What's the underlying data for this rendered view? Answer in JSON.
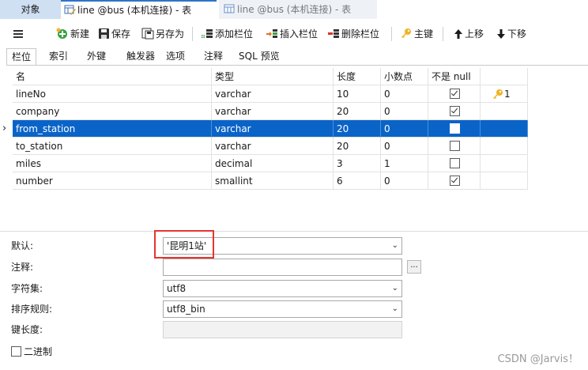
{
  "window_tabs": {
    "object_label": "对象",
    "active_label": "line @bus (本机连接) - 表",
    "inactive_label": "line @bus (本机连接) - 表"
  },
  "toolbar": {
    "new_label": "新建",
    "save_label": "保存",
    "save_as_label": "另存为",
    "add_field_label": "添加栏位",
    "insert_field_label": "插入栏位",
    "delete_field_label": "删除栏位",
    "primary_key_label": "主键",
    "move_up_label": "上移",
    "move_down_label": "下移"
  },
  "sub_tabs": [
    "栏位",
    "索引",
    "外键",
    "触发器",
    "选项",
    "注释",
    "SQL 预览"
  ],
  "grid": {
    "headers": {
      "name": "名",
      "type": "类型",
      "length": "长度",
      "decimals": "小数点",
      "not_null": "不是 null"
    },
    "rows": [
      {
        "name": "lineNo",
        "type": "varchar",
        "length": "10",
        "decimals": "0",
        "not_null": true,
        "key": "1"
      },
      {
        "name": "company",
        "type": "varchar",
        "length": "20",
        "decimals": "0",
        "not_null": true,
        "key": ""
      },
      {
        "name": "from_station",
        "type": "varchar",
        "length": "20",
        "decimals": "0",
        "not_null": false,
        "key": ""
      },
      {
        "name": "to_station",
        "type": "varchar",
        "length": "20",
        "decimals": "0",
        "not_null": false,
        "key": ""
      },
      {
        "name": "miles",
        "type": "decimal",
        "length": "3",
        "decimals": "1",
        "not_null": false,
        "key": ""
      },
      {
        "name": "number",
        "type": "smallint",
        "length": "6",
        "decimals": "0",
        "not_null": true,
        "key": ""
      }
    ],
    "selected_row_index": 2
  },
  "properties": {
    "default_label": "默认:",
    "default_value": "'昆明1站'",
    "comment_label": "注释:",
    "comment_value": "",
    "comment_button": "...",
    "charset_label": "字符集:",
    "charset_value": "utf8",
    "collation_label": "排序规则:",
    "collation_value": "utf8_bin",
    "key_length_label": "键长度:",
    "binary_label": "二进制",
    "binary_checked": false
  },
  "watermark": "CSDN @Jarvis！",
  "colors": {
    "selected_row": "#0a64c8",
    "highlight_box": "#e5352f",
    "accent": "#2e74c9"
  }
}
